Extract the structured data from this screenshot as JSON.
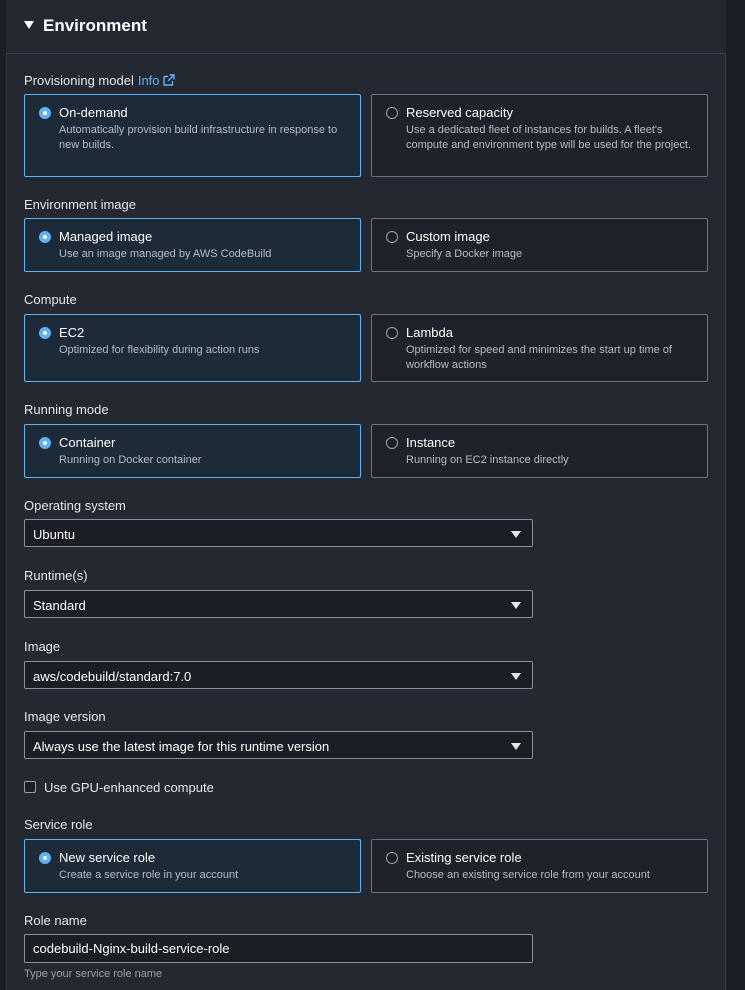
{
  "section": {
    "title": "Environment"
  },
  "provisioning": {
    "label": "Provisioning model",
    "info": "Info",
    "options": [
      {
        "title": "On-demand",
        "desc": "Automatically provision build infrastructure in response to new builds.",
        "selected": true
      },
      {
        "title": "Reserved capacity",
        "desc": "Use a dedicated fleet of instances for builds. A fleet's compute and environment type will be used for the project.",
        "selected": false
      }
    ]
  },
  "env_image": {
    "label": "Environment image",
    "options": [
      {
        "title": "Managed image",
        "desc": "Use an image managed by AWS CodeBuild",
        "selected": true
      },
      {
        "title": "Custom image",
        "desc": "Specify a Docker image",
        "selected": false
      }
    ]
  },
  "compute": {
    "label": "Compute",
    "options": [
      {
        "title": "EC2",
        "desc": "Optimized for flexibility during action runs",
        "selected": true
      },
      {
        "title": "Lambda",
        "desc": "Optimized for speed and minimizes the start up time of workflow actions",
        "selected": false
      }
    ]
  },
  "running_mode": {
    "label": "Running mode",
    "options": [
      {
        "title": "Container",
        "desc": "Running on Docker container",
        "selected": true
      },
      {
        "title": "Instance",
        "desc": "Running on EC2 instance directly",
        "selected": false
      }
    ]
  },
  "os": {
    "label": "Operating system",
    "value": "Ubuntu"
  },
  "runtime": {
    "label": "Runtime(s)",
    "value": "Standard"
  },
  "image": {
    "label": "Image",
    "value": "aws/codebuild/standard:7.0"
  },
  "image_version": {
    "label": "Image version",
    "value": "Always use the latest image for this runtime version"
  },
  "gpu": {
    "label": "Use GPU-enhanced compute",
    "checked": false
  },
  "service_role": {
    "label": "Service role",
    "options": [
      {
        "title": "New service role",
        "desc": "Create a service role in your account",
        "selected": true
      },
      {
        "title": "Existing service role",
        "desc": "Choose an existing service role from your account",
        "selected": false
      }
    ]
  },
  "role_name": {
    "label": "Role name",
    "value": "codebuild-Nginx-build-service-role",
    "hint": "Type your service role name"
  },
  "colors": {
    "accent": "#5fb3f5",
    "panel": "#242931",
    "background": "#1b1f25"
  }
}
